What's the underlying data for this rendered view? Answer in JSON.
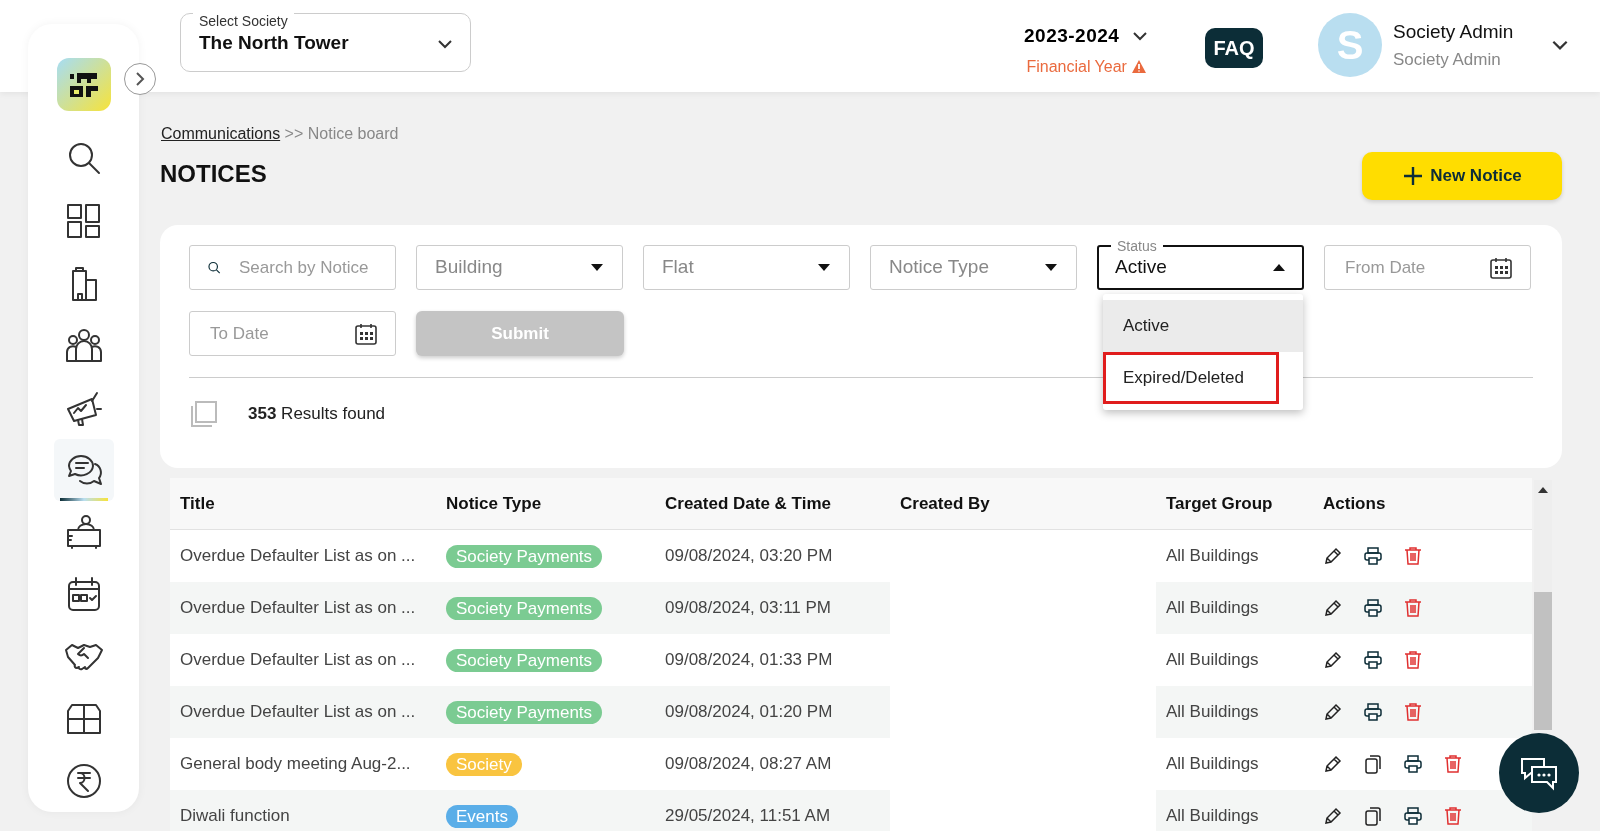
{
  "society_select": {
    "label": "Select Society",
    "value": "The North Tower"
  },
  "financial_year": {
    "value": "2023-2024",
    "label": "Financial Year",
    "warning": true
  },
  "faq": "FAQ",
  "user": {
    "initial": "S",
    "name": "Society Admin",
    "role": "Society Admin"
  },
  "sidebar": {
    "items": [
      {
        "kind": "search",
        "selected": false
      },
      {
        "kind": "dashboard",
        "selected": false
      },
      {
        "kind": "building",
        "selected": false
      },
      {
        "kind": "people",
        "selected": false
      },
      {
        "kind": "megaphone",
        "selected": false
      },
      {
        "kind": "chat",
        "selected": true
      },
      {
        "kind": "desk",
        "selected": false
      },
      {
        "kind": "calendar",
        "selected": false
      },
      {
        "kind": "handshake",
        "selected": false
      },
      {
        "kind": "box",
        "selected": false
      },
      {
        "kind": "rupee",
        "selected": false
      }
    ]
  },
  "breadcrumb": {
    "parent": "Communications",
    "separator": ">>",
    "current": "Notice board"
  },
  "page_title": "NOTICES",
  "new_notice_button": "New Notice",
  "filters": {
    "search": {
      "placeholder": "Search by Notice"
    },
    "building": {
      "placeholder": "Building"
    },
    "flat": {
      "placeholder": "Flat"
    },
    "notice_type": {
      "placeholder": "Notice Type"
    },
    "status": {
      "label": "Status",
      "value": "Active",
      "expanded": true,
      "options": [
        {
          "label": "Active",
          "selected": true,
          "outlined": false
        },
        {
          "label": "Expired/Deleted",
          "selected": false,
          "outlined": true
        }
      ]
    },
    "from_date": {
      "placeholder": "From Date"
    },
    "to_date": {
      "placeholder": "To Date"
    },
    "submit": {
      "label": "Submit",
      "disabled": true
    }
  },
  "results": {
    "select_all_checked": false,
    "text": "**353** Results found"
  },
  "table": {
    "columns": [
      "Title",
      "Notice Type",
      "Created Date & Time",
      "Created By",
      "Target Group",
      "Actions"
    ],
    "rows": [
      {
        "title": "Overdue Defaulter List as on ...",
        "type": {
          "label": "Society Payments",
          "color": "#7bcb92"
        },
        "created": "09/08/2024, 03:20 PM",
        "target": "All Buildings",
        "actions": [
          {
            "kind": "edit"
          },
          {
            "kind": "print"
          },
          {
            "kind": "delete"
          }
        ]
      },
      {
        "title": "Overdue Defaulter List as on ...",
        "type": {
          "label": "Society Payments",
          "color": "#7bcb92"
        },
        "created": "09/08/2024, 03:11 PM",
        "target": "All Buildings",
        "actions": [
          {
            "kind": "edit"
          },
          {
            "kind": "print"
          },
          {
            "kind": "delete"
          }
        ]
      },
      {
        "title": "Overdue Defaulter List as on ...",
        "type": {
          "label": "Society Payments",
          "color": "#7bcb92"
        },
        "created": "09/08/2024, 01:33 PM",
        "target": "All Buildings",
        "actions": [
          {
            "kind": "edit"
          },
          {
            "kind": "print"
          },
          {
            "kind": "delete"
          }
        ]
      },
      {
        "title": "Overdue Defaulter List as on ...",
        "type": {
          "label": "Society Payments",
          "color": "#7bcb92"
        },
        "created": "09/08/2024, 01:20 PM",
        "target": "All Buildings",
        "actions": [
          {
            "kind": "edit"
          },
          {
            "kind": "print"
          },
          {
            "kind": "delete"
          }
        ]
      },
      {
        "title": "General body meeting Aug-2...",
        "type": {
          "label": "Society",
          "color": "#f9c440"
        },
        "created": "09/08/2024, 08:27 AM",
        "target": "All Buildings",
        "actions": [
          {
            "kind": "edit"
          },
          {
            "kind": "copy"
          },
          {
            "kind": "print"
          },
          {
            "kind": "delete"
          }
        ]
      },
      {
        "title": "Diwali function",
        "type": {
          "label": "Events",
          "color": "#5aaee8"
        },
        "created": "29/05/2024, 11:51 AM",
        "target": "All Buildings",
        "actions": [
          {
            "kind": "edit"
          },
          {
            "kind": "copy"
          },
          {
            "kind": "print"
          },
          {
            "kind": "delete"
          }
        ]
      }
    ]
  }
}
